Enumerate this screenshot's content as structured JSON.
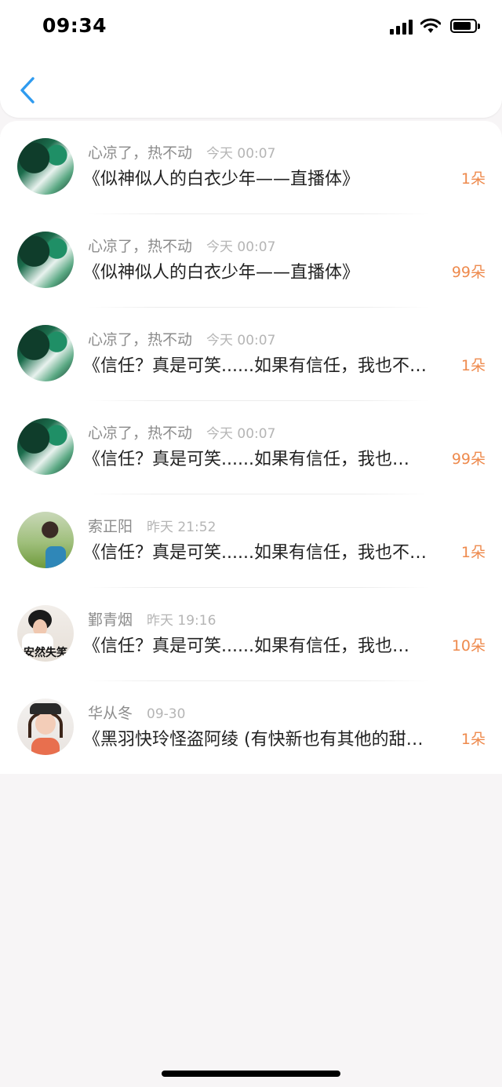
{
  "status_bar": {
    "time": "09:34"
  },
  "items": [
    {
      "name": "心凉了，热不动",
      "time": "今天 00:07",
      "title": "《似神似人的白衣少年——直播体》",
      "flowers": "1朵",
      "avatar": "green-art-avatar"
    },
    {
      "name": "心凉了，热不动",
      "time": "今天 00:07",
      "title": "《似神似人的白衣少年——直播体》",
      "flowers": "99朵",
      "avatar": "green-art-avatar"
    },
    {
      "name": "心凉了，热不动",
      "time": "今天 00:07",
      "title": "《信任？真是可笑......如果有信任，我也不…",
      "flowers": "1朵",
      "avatar": "green-art-avatar"
    },
    {
      "name": "心凉了，热不动",
      "time": "今天 00:07",
      "title": "《信任？真是可笑......如果有信任，我也…",
      "flowers": "99朵",
      "avatar": "green-art-avatar"
    },
    {
      "name": "索正阳",
      "time": "昨天 21:52",
      "title": "《信任？真是可笑......如果有信任，我也不…",
      "flowers": "1朵",
      "avatar": "boy-photo-avatar"
    },
    {
      "name": "鄞青烟",
      "time": "昨天 19:16",
      "title": "《信任？真是可笑......如果有信任，我也…",
      "flowers": "10朵",
      "avatar": "girl-photo-avatar",
      "avatar_caption": "安然失笑"
    },
    {
      "name": "华从冬",
      "time": "09-30",
      "title": "《黑羽快玲怪盗阿绫 (有快新也有其他的甜…",
      "flowers": "1朵",
      "avatar": "girl-hat-avatar"
    }
  ],
  "colors": {
    "accent": "#2f9bef",
    "flowers": "#ee8a4d"
  }
}
